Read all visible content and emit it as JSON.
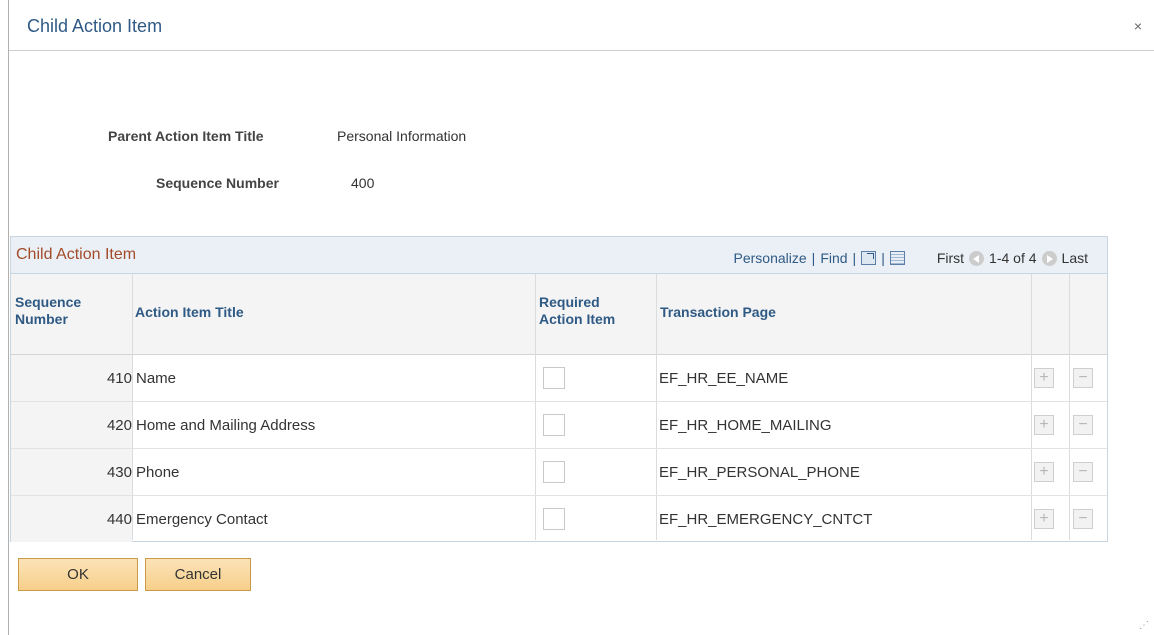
{
  "dialog": {
    "title": "Child Action Item",
    "close_label": "×"
  },
  "fields": {
    "parent_title_label": "Parent Action Item Title",
    "parent_title_value": "Personal Information",
    "sequence_label": "Sequence Number",
    "sequence_value": "400"
  },
  "grid": {
    "title": "Child Action Item",
    "personalize": "Personalize",
    "find": "Find",
    "sep": "|",
    "first": "First",
    "range": "1-4 of 4",
    "last": "Last",
    "columns": {
      "seq_line1": "Sequence",
      "seq_line2": "Number",
      "title": "Action Item Title",
      "req_line1": "Required",
      "req_line2": "Action Item",
      "page": "Transaction Page"
    },
    "rows": [
      {
        "seq": "410",
        "title": "Name",
        "required": false,
        "page": "EF_HR_EE_NAME"
      },
      {
        "seq": "420",
        "title": "Home and Mailing Address",
        "required": false,
        "page": "EF_HR_HOME_MAILING"
      },
      {
        "seq": "430",
        "title": "Phone",
        "required": false,
        "page": "EF_HR_PERSONAL_PHONE"
      },
      {
        "seq": "440",
        "title": "Emergency Contact",
        "required": false,
        "page": "EF_HR_EMERGENCY_CNTCT"
      }
    ],
    "add_symbol": "+",
    "delete_symbol": "−"
  },
  "buttons": {
    "ok": "OK",
    "cancel": "Cancel"
  },
  "icons": {
    "close": "close-icon",
    "zoom": "zoom-grid-icon",
    "download": "download-spreadsheet-icon",
    "prev": "previous-arrow-icon",
    "next": "next-arrow-icon",
    "resize": "resize-grip-icon"
  }
}
